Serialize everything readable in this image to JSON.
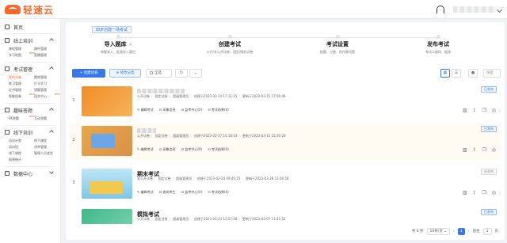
{
  "brand": {
    "name": "轻速云"
  },
  "sidebar": {
    "home": "首页",
    "groups": [
      {
        "label": "线上培训",
        "items": [
          {
            "label": "课程管理",
            "new": false
          },
          {
            "label": "课件管理",
            "new": false
          },
          {
            "label": "学习地图",
            "new": true
          },
          {
            "label": "直播管理",
            "new": false
          }
        ]
      },
      {
        "label": "考试管理",
        "items": [
          {
            "label": "我的试卷",
            "new": false,
            "active": true
          },
          {
            "label": "题库管理",
            "new": false
          },
          {
            "label": "练习管理",
            "new": false
          },
          {
            "label": "打卡学习",
            "new": false
          },
          {
            "label": "证书管理",
            "new": false
          },
          {
            "label": "错题管理",
            "new": false
          },
          {
            "label": "智能组卷",
            "new": true
          },
          {
            "label": "闯关中心",
            "new": true
          }
        ]
      },
      {
        "label": "趣味答题",
        "items": [
          {
            "label": "PK答题",
            "new": true
          },
          {
            "label": "互动答题",
            "new": false
          }
        ]
      },
      {
        "label": "线下培训",
        "items": [
          {
            "label": "培训计划",
            "new": false
          },
          {
            "label": "线下课程",
            "new": false
          },
          {
            "label": "培训班",
            "new": false
          },
          {
            "label": "讲师管理",
            "new": false
          },
          {
            "label": "线下课程",
            "new": false
          },
          {
            "label": "管理人员类型",
            "new": false
          },
          {
            "label": "报表统计",
            "new": false
          }
        ]
      },
      {
        "label": "数据中心",
        "items": []
      }
    ]
  },
  "main": {
    "steps_tab": "四步创建一场考试",
    "steps": [
      {
        "title": "导入题库",
        "desc": "单题录入、批量导入题目",
        "ext": "↗"
      },
      {
        "title": "创建考试",
        "desc": "公开/非公开试卷、固定/随机试卷",
        "ext": ""
      },
      {
        "title": "考试设置",
        "desc": "抽题、分数、防作弊设置",
        "ext": ""
      },
      {
        "title": "发布考试",
        "desc": "考试二维码、链接",
        "ext": ""
      }
    ],
    "toolbar": {
      "create": "+ 创建试卷",
      "category": "⊕ 修改分类",
      "select_all": "全选",
      "refresh": "↻",
      "more": "⌄",
      "search": "搜索"
    },
    "rows": [
      {
        "num": "1",
        "title": "",
        "access": "公开试卷",
        "type": "固定试卷",
        "perm": "超级管理员",
        "created": "创建于2023-03-14 17:11:25",
        "updated": "更新于2023-03-15 17:00:46",
        "acts": [
          "✎ 编辑考试",
          "⊟ 采集信息",
          "⊟ 监考中心(0)",
          "⊟ 考试结果(0)"
        ],
        "status": "已发布",
        "status_type": "blue",
        "thumb_colors": [
          "#f28c28",
          "#f5b45a"
        ]
      },
      {
        "num": "2",
        "title": "",
        "access": "公开试卷",
        "type": "固定试卷",
        "perm": "超级管理员",
        "created": "创建于2023-02-27 10:18:54",
        "updated": "更新于2023-03-15 15:30:28",
        "acts": [
          "✎ 编辑考试",
          "⊟ 采集信息",
          "⊟ 监考中心(0)",
          "⊟ 考试结果(0)"
        ],
        "status": "已发布",
        "status_type": "blue",
        "thumb_colors": [
          "#e8a84a",
          "#d9914a"
        ]
      },
      {
        "num": "3",
        "title": "期末考试",
        "access": "非公开试卷",
        "type": "固定试卷",
        "perm": "超级管理员",
        "created": "创建于2023-02-24 09:40:25",
        "updated": "更新于2023-03-28 13:36:58",
        "acts": [
          "✎ 编辑考试",
          "⊟ 查阅考生",
          "⊟ 监考中心(0)",
          "⊟ 考试结果(0)"
        ],
        "status": "未发布",
        "status_type": "gray",
        "thumb_colors": [
          "#7dc7e8",
          "#f2c94c"
        ]
      },
      {
        "num": "4",
        "title": "模拟考试",
        "access": "公开试卷",
        "type": "固定试卷",
        "perm": "超级管理员",
        "created": "创建于2023-01-13 13:57:08",
        "updated": "更新于2023-03-07 11:41:52",
        "acts": [],
        "status": "已发布",
        "status_type": "blue",
        "thumb_colors": [
          "#3fb98a",
          "#f2c94c"
        ]
      }
    ],
    "pager": {
      "total": "共 4 条",
      "page_size": "10条/页",
      "prev": "‹",
      "current": "1",
      "next": "›",
      "goto": "前往",
      "goto_value": "1",
      "page": "页"
    }
  }
}
